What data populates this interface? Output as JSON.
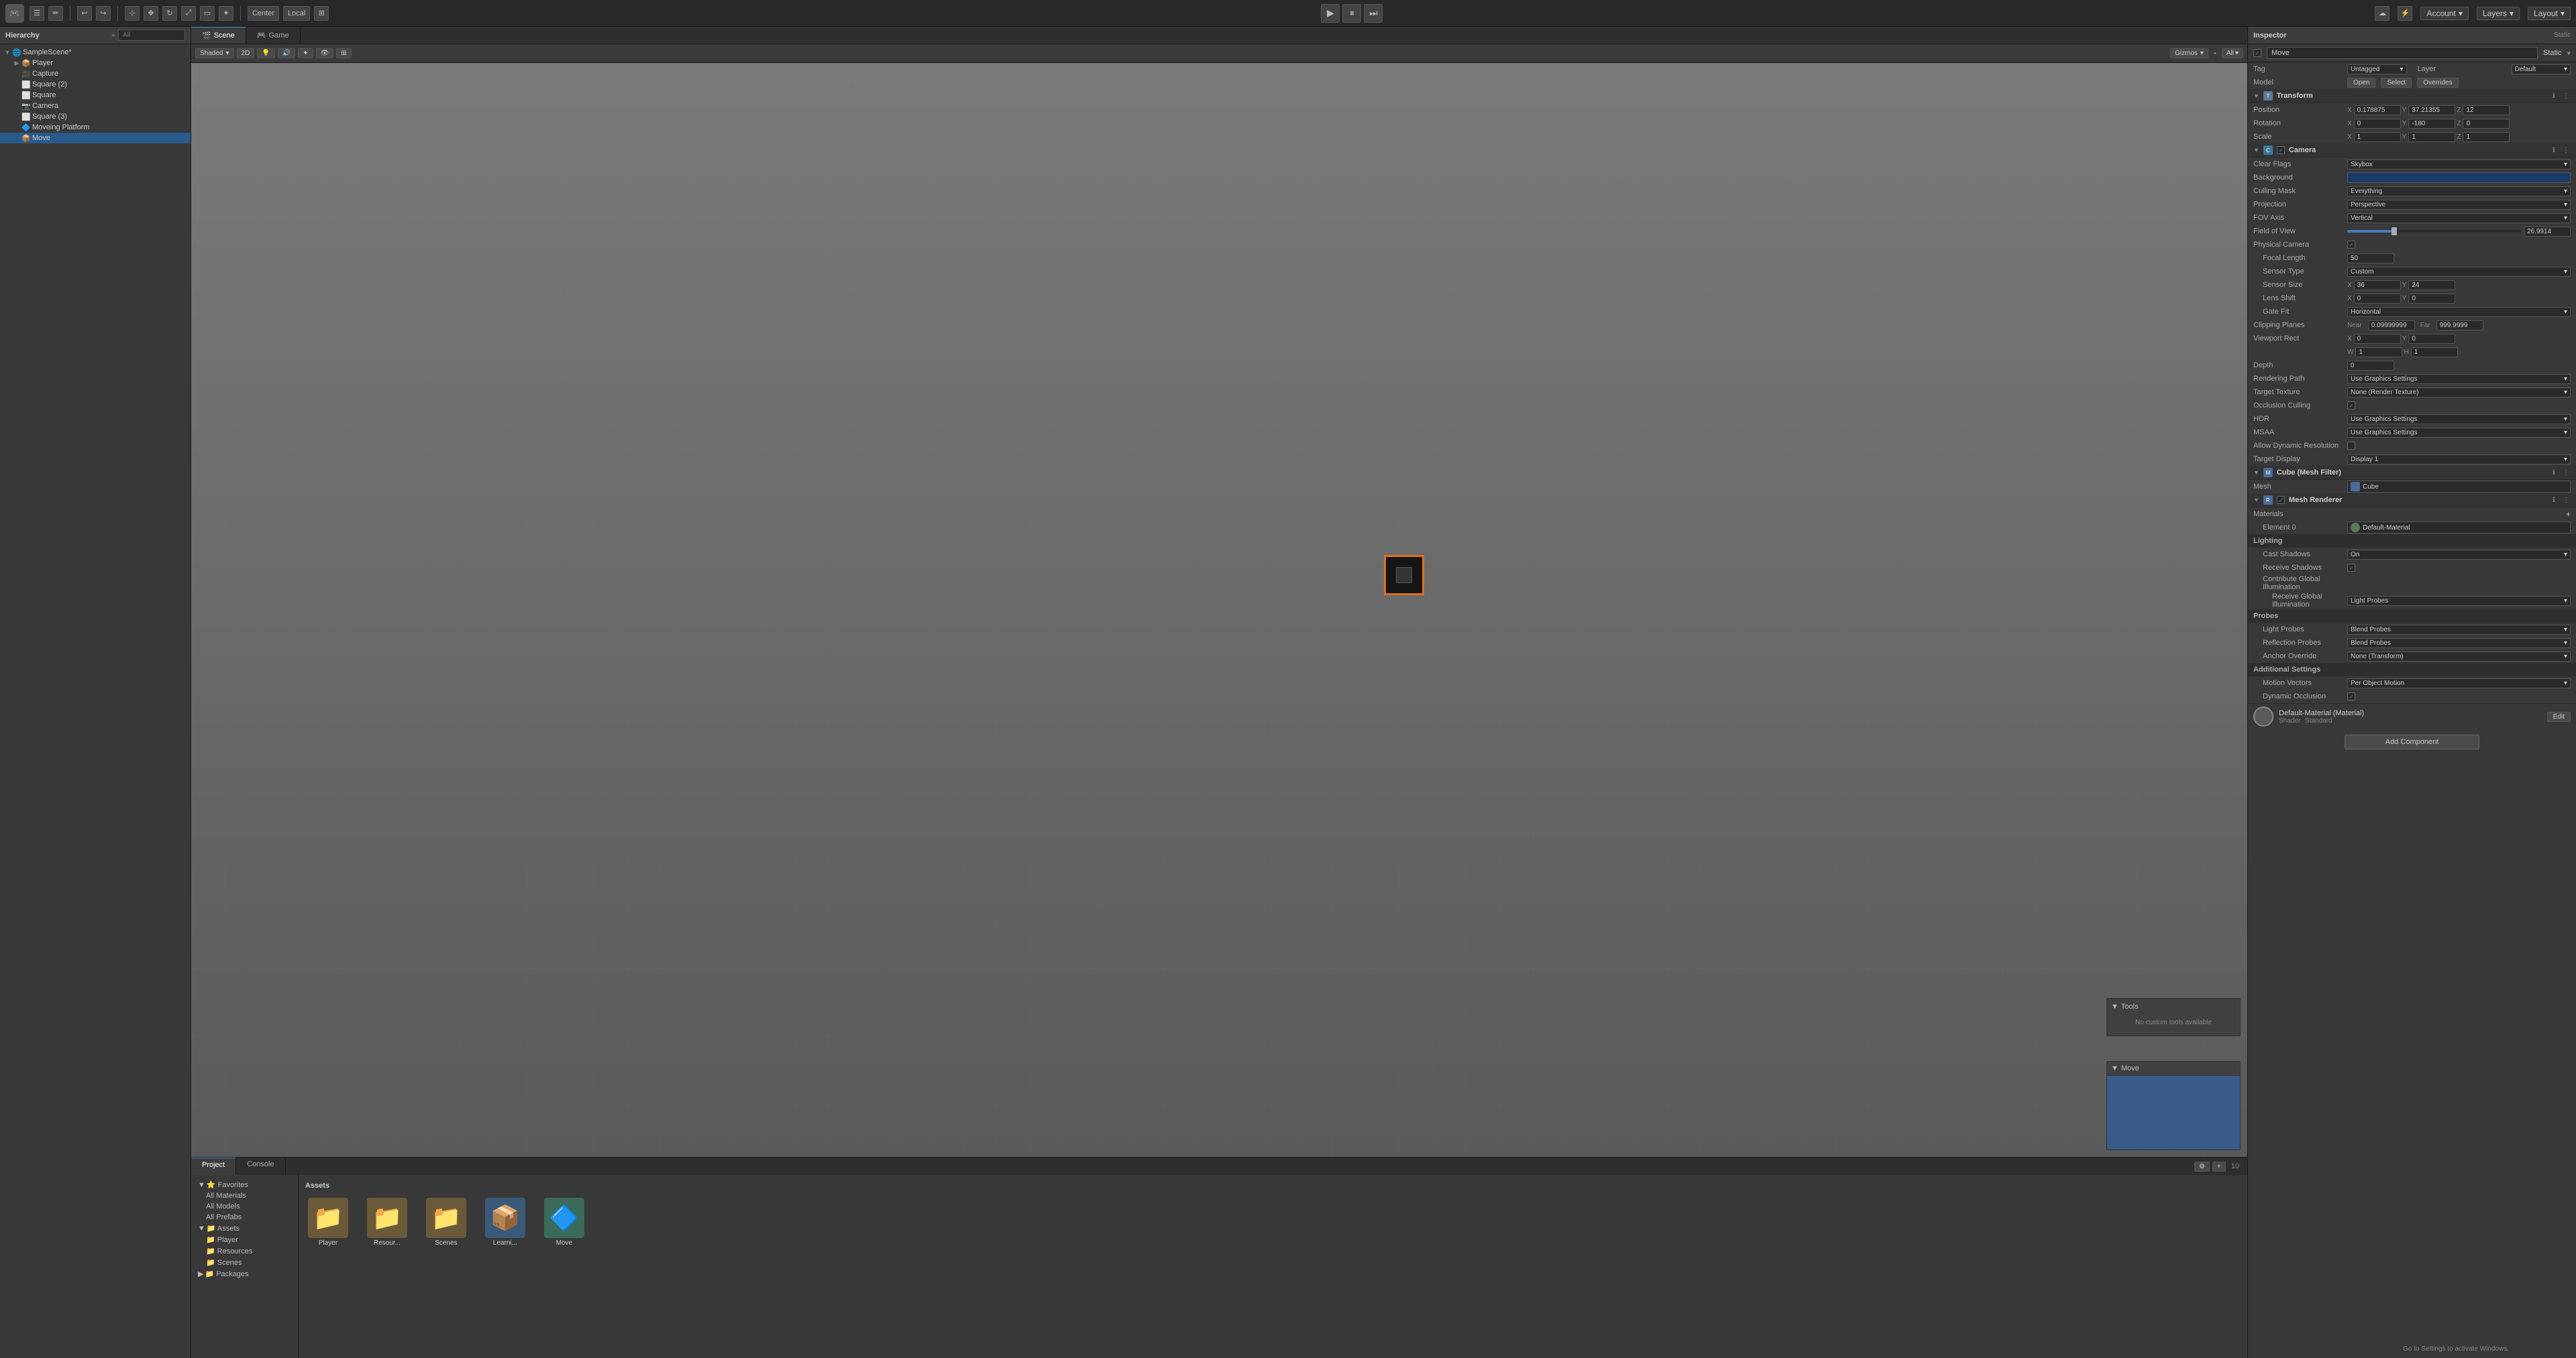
{
  "topbar": {
    "logo": "U",
    "icons": [
      "file",
      "edit",
      "undo",
      "redo",
      "cut",
      "copy",
      "paste",
      "delete"
    ],
    "center_label": "",
    "account_label": "Account",
    "layers_label": "Layers",
    "layout_label": "Layout",
    "play": "▶",
    "pause": "⏸",
    "step": "⏭"
  },
  "hierarchy": {
    "title": "Hierarchy",
    "search_placeholder": "All",
    "items": [
      {
        "label": "SampleScene*",
        "depth": 0,
        "icon": "🌐",
        "expanded": true,
        "modified": true
      },
      {
        "label": "Player",
        "depth": 1,
        "icon": "📦"
      },
      {
        "label": "Capture",
        "depth": 1,
        "icon": "🎥"
      },
      {
        "label": "Square (2)",
        "depth": 1,
        "icon": "⬜"
      },
      {
        "label": "Square",
        "depth": 1,
        "icon": "⬜"
      },
      {
        "label": "Camera",
        "depth": 1,
        "icon": "📷"
      },
      {
        "label": "Square (3)",
        "depth": 1,
        "icon": "⬜"
      },
      {
        "label": "Moveing Platform",
        "depth": 1,
        "icon": "🔷"
      },
      {
        "label": "Move",
        "depth": 1,
        "icon": "📦",
        "selected": true
      }
    ]
  },
  "scene": {
    "tabs": [
      {
        "label": "Scene",
        "icon": "🎬",
        "active": true
      },
      {
        "label": "Game",
        "icon": "🎮",
        "active": false
      }
    ],
    "toolbar": {
      "shaded_label": "Shaded",
      "mode_2d": "2D",
      "gizmos_label": "Gizmos",
      "all_label": "All"
    },
    "gizmos_label": "Gizmos",
    "all_label": "All",
    "tools_panel": {
      "title": "Tools",
      "content": "No custom tools available"
    },
    "move_panel": {
      "title": "Move"
    }
  },
  "bottom": {
    "tabs": [
      {
        "label": "Project",
        "active": true
      },
      {
        "label": "Console",
        "active": false
      }
    ],
    "assets_header": "Assets",
    "sidebar_items": [
      {
        "label": "Favorites",
        "expanded": true
      },
      {
        "label": "All Materials",
        "depth": 1
      },
      {
        "label": "All Models",
        "depth": 1
      },
      {
        "label": "All Prefabs",
        "depth": 1
      },
      {
        "label": "Assets",
        "expanded": true
      },
      {
        "label": "Player",
        "depth": 1
      },
      {
        "label": "Resources",
        "depth": 1
      },
      {
        "label": "Scenes",
        "depth": 1
      },
      {
        "label": "Packages",
        "expanded": false
      }
    ],
    "assets": [
      {
        "label": "Player",
        "icon": "📁",
        "color": "#6a6a6a"
      },
      {
        "label": "Resour...",
        "icon": "📁",
        "color": "#6a6a6a"
      },
      {
        "label": "Scenes",
        "icon": "📁",
        "color": "#6a6a6a"
      },
      {
        "label": "Learni...",
        "icon": "📦",
        "color": "#4a7abd"
      },
      {
        "label": "Move",
        "icon": "🔷",
        "color": "#5a9a5a"
      }
    ]
  },
  "inspector": {
    "title": "Inspector",
    "static_label": "Static",
    "object_name": "Move",
    "tag": "Untagged",
    "layer": "Default",
    "model_label": "Model",
    "open_label": "Open",
    "select_label": "Select",
    "overrides_label": "Overrides",
    "transform": {
      "title": "Transform",
      "position": {
        "x": "0.178875",
        "y": "37.21355",
        "z": "12"
      },
      "rotation": {
        "x": "0",
        "y": "-180",
        "z": "0"
      },
      "scale": {
        "x": "1",
        "y": "1",
        "z": "1"
      }
    },
    "camera": {
      "title": "Camera",
      "clear_flags": "Skybox",
      "background_color": "#1a3a6a",
      "culling_mask": "Everything",
      "projection": "Perspective",
      "fov_axis": "Vertical",
      "field_of_view": "26.9914",
      "field_of_view_slider_pct": 27,
      "physical_camera": true,
      "focal_length": "50",
      "sensor_type": "Custom",
      "sensor_size_x": "36",
      "sensor_size_y": "24",
      "lens_shift_x": "0",
      "lens_shift_y": "0",
      "gate_fit": "Horizontal",
      "clipping_near": "0.09999999",
      "clipping_far": "999.9999",
      "viewport_x": "0",
      "viewport_y": "0",
      "viewport_w": "1",
      "viewport_h": "1",
      "depth": "0",
      "rendering_path": "Use Graphics Settings",
      "target_texture": "None (Render Texture)",
      "occlusion_culling": true,
      "hdr": "Use Graphics Settings",
      "msaa": "Use Graphics Settings",
      "allow_dynamic_resolution": false,
      "target_display": "Display 1"
    },
    "cube_mesh_filter": {
      "title": "Cube (Mesh Filter)",
      "mesh": "Cube"
    },
    "mesh_renderer": {
      "title": "Mesh Renderer",
      "element_0": "Default-Material"
    },
    "lighting": {
      "cast_shadows": "On",
      "receive_shadows": true,
      "contribute_gi": false,
      "receive_gi": "Light Probes"
    },
    "probes": {
      "light_probes": "Blend Probes",
      "reflection_probes": "Blend Probes",
      "anchor_override": "None (Transform)"
    },
    "additional_settings": {
      "title": "Additional Settings",
      "motion_vectors": "Per Object Motion",
      "dynamic_occlusion": true
    },
    "material": {
      "name": "Default-Material (Material)",
      "shader": "Standard",
      "edit_label": "Edit"
    },
    "add_component_label": "Add Component"
  }
}
